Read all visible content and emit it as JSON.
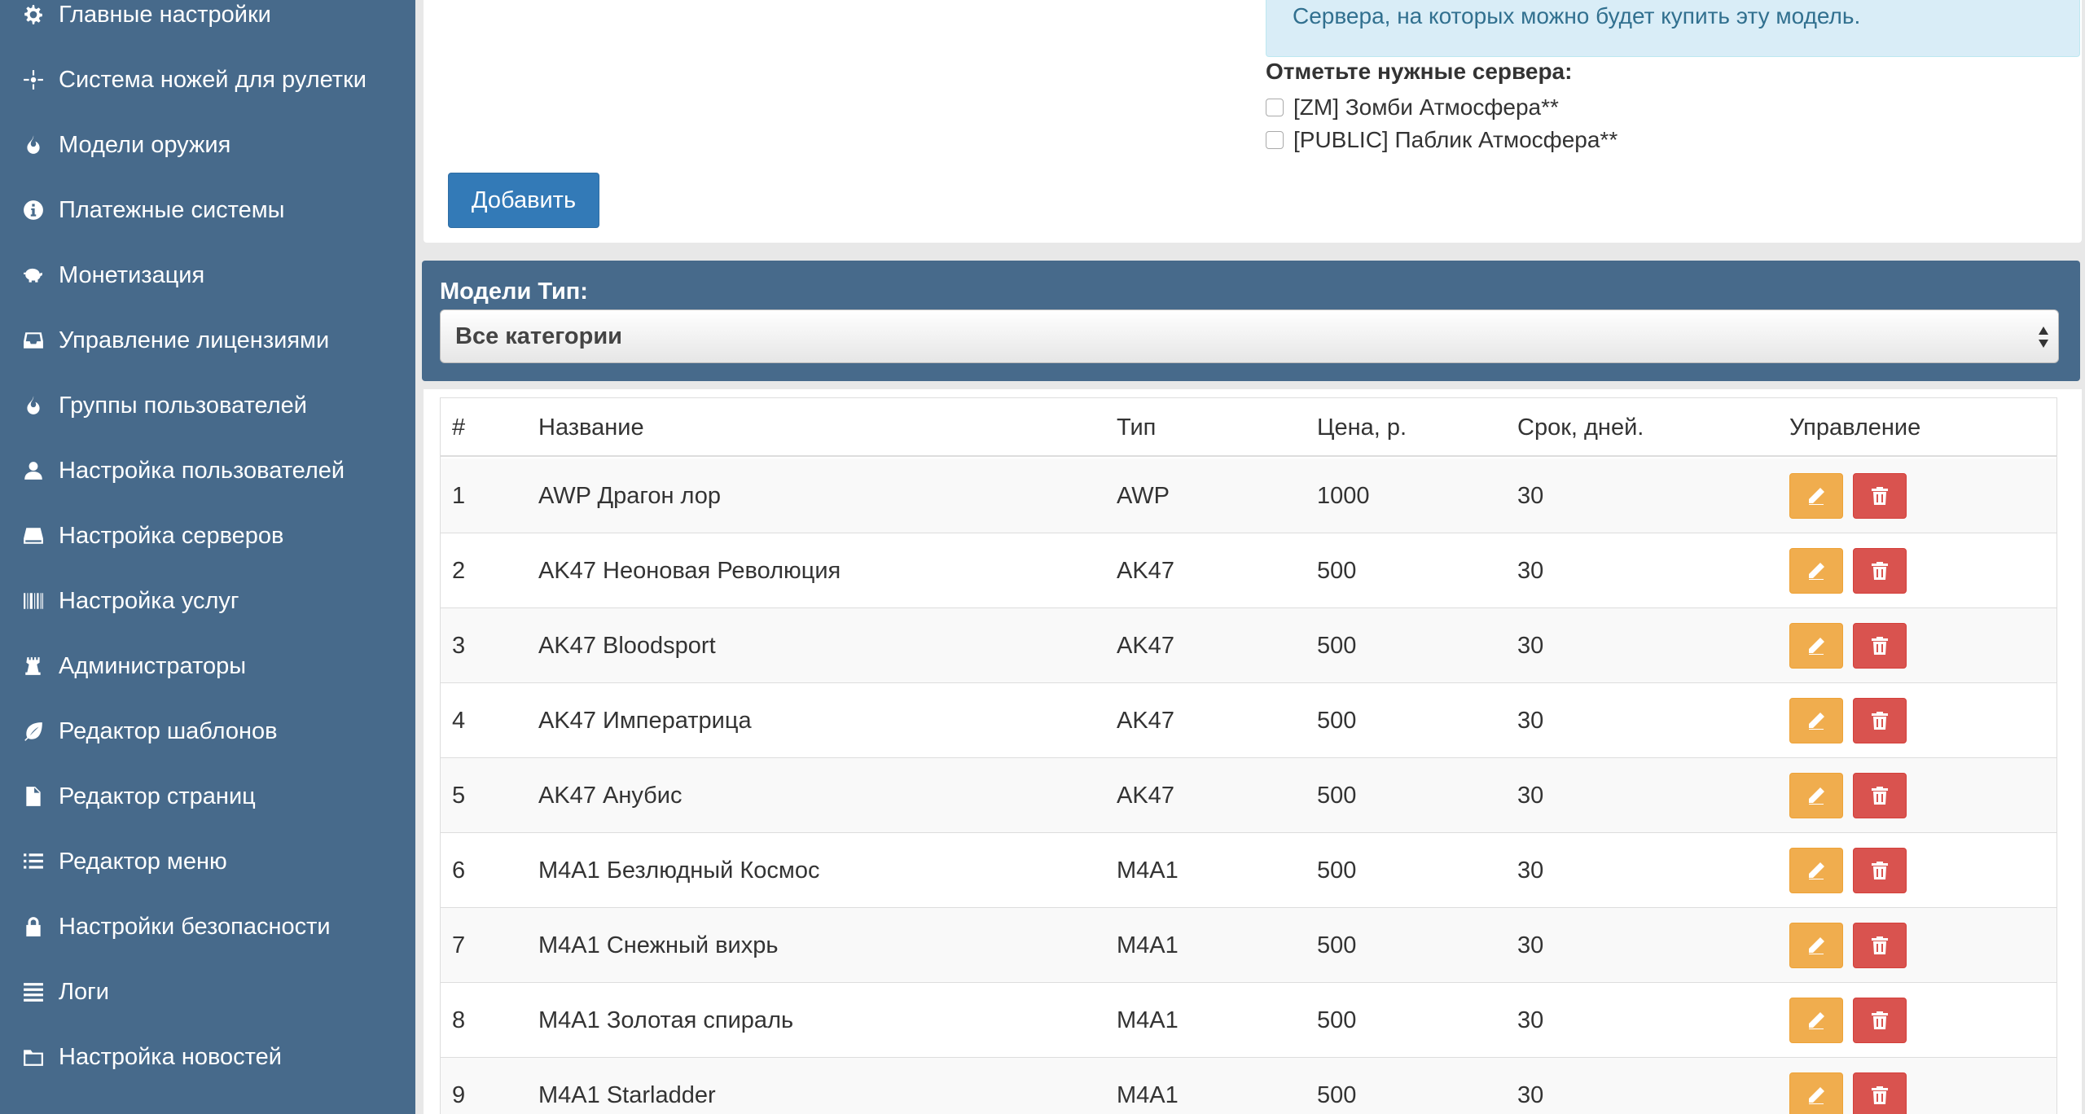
{
  "sidebar": {
    "items": [
      {
        "label": "Главные настройки",
        "icon": "gear-icon"
      },
      {
        "label": "Система ножей для рулетки",
        "icon": "crosshair-icon"
      },
      {
        "label": "Модели оружия",
        "icon": "fire-icon"
      },
      {
        "label": "Платежные системы",
        "icon": "info-icon"
      },
      {
        "label": "Монетизация",
        "icon": "piggy-bank-icon"
      },
      {
        "label": "Управление лицензиями",
        "icon": "inbox-icon"
      },
      {
        "label": "Группы пользователей",
        "icon": "fire-icon"
      },
      {
        "label": "Настройка пользователей",
        "icon": "user-icon"
      },
      {
        "label": "Настройка серверов",
        "icon": "hdd-icon"
      },
      {
        "label": "Настройка услуг",
        "icon": "barcode-icon"
      },
      {
        "label": "Администраторы",
        "icon": "tower-icon"
      },
      {
        "label": "Редактор шаблонов",
        "icon": "leaf-icon"
      },
      {
        "label": "Редактор страниц",
        "icon": "file-icon"
      },
      {
        "label": "Редактор меню",
        "icon": "list-icon"
      },
      {
        "label": "Настройки безопасности",
        "icon": "lock-icon"
      },
      {
        "label": "Логи",
        "icon": "align-justify-icon"
      },
      {
        "label": "Настройка новостей",
        "icon": "folder-icon"
      }
    ]
  },
  "form": {
    "info_text": "Сервера, на которых можно будет купить эту модель.",
    "servers_label": "Отметьте нужные сервера:",
    "servers": [
      {
        "label": "[ZM] Зомби Атмосфера**",
        "checked": false
      },
      {
        "label": "[PUBLIC] Паблик Атмосфера**",
        "checked": false
      }
    ],
    "add_label": "Добавить"
  },
  "filter": {
    "label": "Модели Тип:",
    "selected": "Все категории"
  },
  "table": {
    "headers": [
      "#",
      "Название",
      "Тип",
      "Цена, р.",
      "Срок, дней.",
      "Управление"
    ],
    "rows": [
      [
        "1",
        "AWP Драгон лор",
        "AWP",
        "1000",
        "30"
      ],
      [
        "2",
        "AK47 Неоновая Революция",
        "AK47",
        "500",
        "30"
      ],
      [
        "3",
        "AK47 Bloodsport",
        "AK47",
        "500",
        "30"
      ],
      [
        "4",
        "AK47 Императрица",
        "AK47",
        "500",
        "30"
      ],
      [
        "5",
        "AK47 Анубис",
        "AK47",
        "500",
        "30"
      ],
      [
        "6",
        "M4A1 Безлюдный Космос",
        "M4A1",
        "500",
        "30"
      ],
      [
        "7",
        "M4A1 Снежный вихрь",
        "M4A1",
        "500",
        "30"
      ],
      [
        "8",
        "M4A1 Золотая спираль",
        "M4A1",
        "500",
        "30"
      ],
      [
        "9",
        "M4A1 Starladder",
        "M4A1",
        "500",
        "30"
      ]
    ]
  },
  "colors": {
    "sidebar_bg": "#476a8b",
    "primary": "#337ab7",
    "warning": "#f0ad4e",
    "danger": "#d9534f",
    "info_bg": "#d9edf7"
  }
}
